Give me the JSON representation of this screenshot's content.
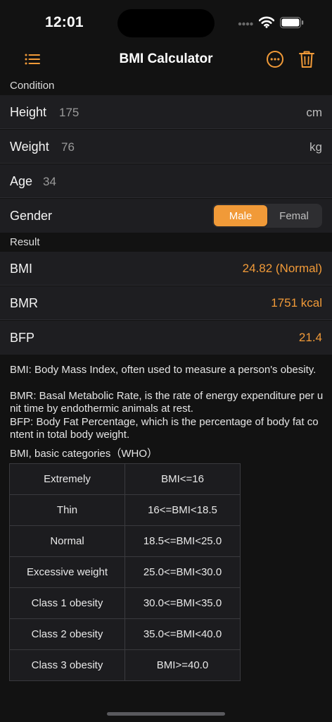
{
  "status_bar": {
    "time": "12:01"
  },
  "nav": {
    "title": "BMI Calculator",
    "accent_color": "#f19a38",
    "left_icon": "list-icon",
    "right_icons": [
      "more-circle-icon",
      "trash-icon"
    ]
  },
  "condition": {
    "header": "Condition",
    "height": {
      "label": "Height",
      "value": "175",
      "unit": "cm"
    },
    "weight": {
      "label": "Weight",
      "value": "76",
      "unit": "kg"
    },
    "age": {
      "label": "Age",
      "value": "34"
    },
    "gender": {
      "label": "Gender",
      "options": [
        "Male",
        "Femal"
      ],
      "selected": "Male"
    }
  },
  "result": {
    "header": "Result",
    "bmi": {
      "label": "BMI",
      "value": "24.82 (Normal)"
    },
    "bmr": {
      "label": "BMR",
      "value": "1751 kcal"
    },
    "bfp": {
      "label": "BFP",
      "value": "21.4"
    }
  },
  "descriptions": {
    "bmi": "BMI: Body Mass Index, often used to measure a person's obesity.",
    "bmr": "BMR: Basal Metabolic Rate, is the rate of energy expenditure per unit time by endothermic animals at rest.",
    "bfp": "BFP: Body Fat Percentage, which is the percentage of body fat content in total body weight."
  },
  "who_table": {
    "title": "BMI, basic categories（WHO）",
    "rows": [
      {
        "category": "Extremely",
        "range": "BMI<=16"
      },
      {
        "category": "Thin",
        "range": "16<=BMI<18.5"
      },
      {
        "category": "Normal",
        "range": "18.5<=BMI<25.0"
      },
      {
        "category": "Excessive weight",
        "range": "25.0<=BMI<30.0"
      },
      {
        "category": "Class 1 obesity",
        "range": "30.0<=BMI<35.0"
      },
      {
        "category": "Class 2 obesity",
        "range": "35.0<=BMI<40.0"
      },
      {
        "category": "Class 3 obesity",
        "range": "BMI>=40.0"
      }
    ]
  }
}
